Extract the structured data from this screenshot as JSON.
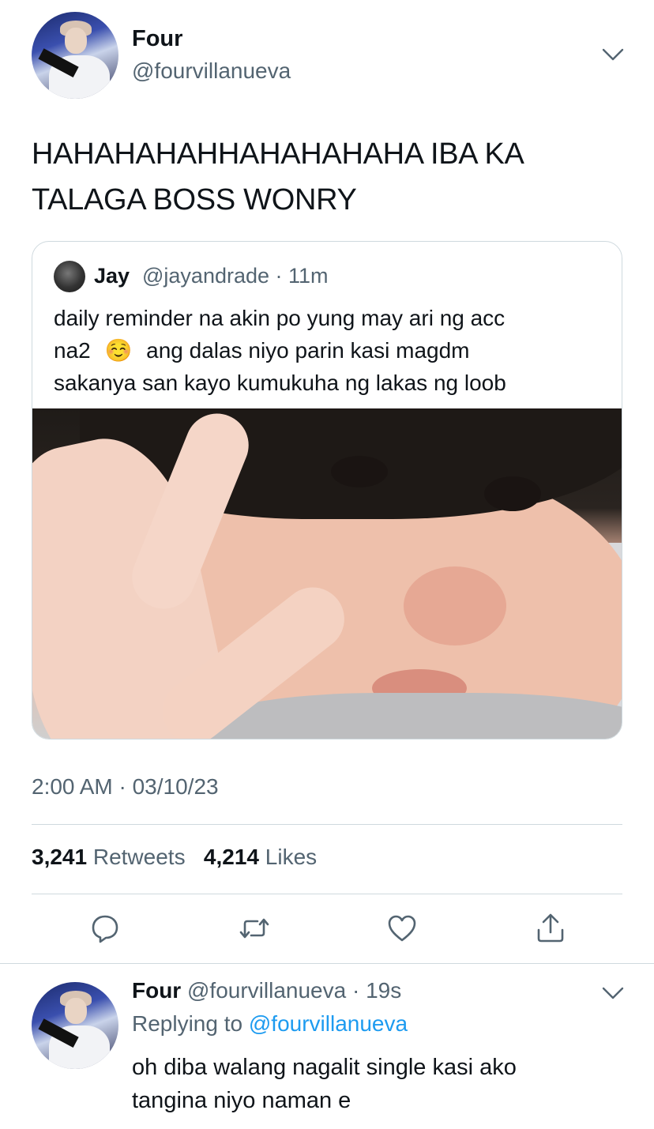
{
  "tweet": {
    "author_name": "Four",
    "author_handle": "@fourvillanueva",
    "text_line1": "HAHAHAHAHHAHAHAHAHA IBA KA",
    "text_line2": "TALAGA BOSS WONRY",
    "timestamp": "2:00 AM · 03/10/23",
    "retweets_count": "3,241",
    "retweets_label": "Retweets",
    "likes_count": "4,214",
    "likes_label": "Likes"
  },
  "quoted": {
    "author_name": "Jay",
    "author_handle": "@jayandrade",
    "time": "11m",
    "line1": "daily reminder na akin po yung may ari ng acc",
    "line2_a": "na2",
    "line2_emoji": "☺️",
    "line2_b": "ang dalas niyo parin kasi magdm",
    "line3": "sakanya san kayo kumukuha ng lakas ng loob"
  },
  "reply": {
    "author_name": "Four",
    "author_handle": "@fourvillanueva",
    "time": "19s",
    "replying_prefix": "Replying to",
    "replying_to": "@fourvillanueva",
    "line1": "oh diba walang nagalit single kasi ako",
    "line2": "tangina niyo naman e"
  },
  "icons": [
    "chevron-down-icon",
    "reply-icon",
    "retweet-icon",
    "like-icon",
    "share-icon"
  ],
  "colors": {
    "text": "#0f1419",
    "secondary": "#536471",
    "link": "#1d9bf0",
    "border": "#cfd9de"
  }
}
